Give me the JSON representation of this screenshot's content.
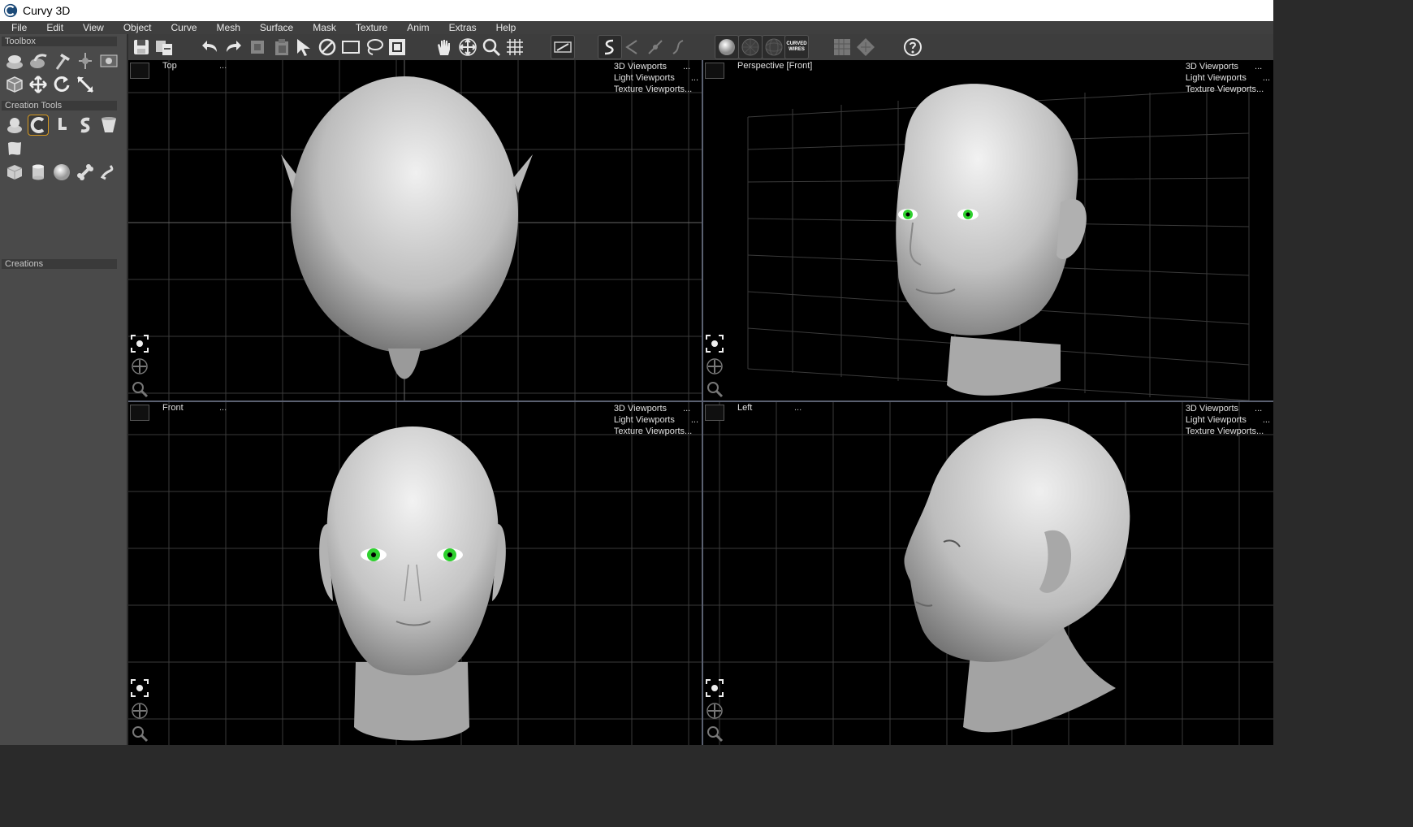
{
  "window": {
    "title": "Curvy 3D"
  },
  "menubar": [
    "File",
    "Edit",
    "View",
    "Object",
    "Curve",
    "Mesh",
    "Surface",
    "Mask",
    "Texture",
    "Anim",
    "Extras",
    "Help"
  ],
  "toolbar": {
    "buttons": [
      "save-icon",
      "save-copy-icon",
      "undo-icon",
      "redo-icon",
      "copy-icon",
      "paste-icon",
      "select-arrow-icon",
      "null-select-icon",
      "rectangle-select-icon",
      "lasso-select-icon",
      "object-select-icon",
      "hand-pan-icon",
      "move-icon",
      "zoom-icon",
      "grid-icon",
      "measure-icon",
      "curve-draw-icon",
      "curve-edit-icon",
      "curve-point-icon",
      "curve-smooth-icon",
      "shaded-sphere-icon",
      "wire-sphere-icon",
      "mesh-sphere-icon",
      "curved-wires-icon",
      "texture-plane-icon",
      "texture-diamond-icon",
      "help-icon"
    ],
    "curved_wires_label": "CURVED WIRES"
  },
  "leftpanel": {
    "toolbox_title": "Toolbox",
    "creation_tools_title": "Creation Tools",
    "creations_title": "Creations",
    "selected_tool": "lathe-tool-icon"
  },
  "viewports": {
    "menu": {
      "item1": "3D Viewports",
      "item2": "Light Viewports",
      "item3": "Texture Viewports...",
      "dots": "..."
    },
    "top": {
      "name": "Top",
      "dots": "..."
    },
    "perspective": {
      "name": "Perspective [Front]"
    },
    "front": {
      "name": "Front",
      "dots": "..."
    },
    "left": {
      "name": "Left",
      "dots": "..."
    }
  },
  "colors": {
    "iris": "#2fd12f",
    "skin": "#c8c8c8",
    "accent": "#d89a20",
    "viewport_bg": "#000000",
    "divider": "#5a6070"
  }
}
